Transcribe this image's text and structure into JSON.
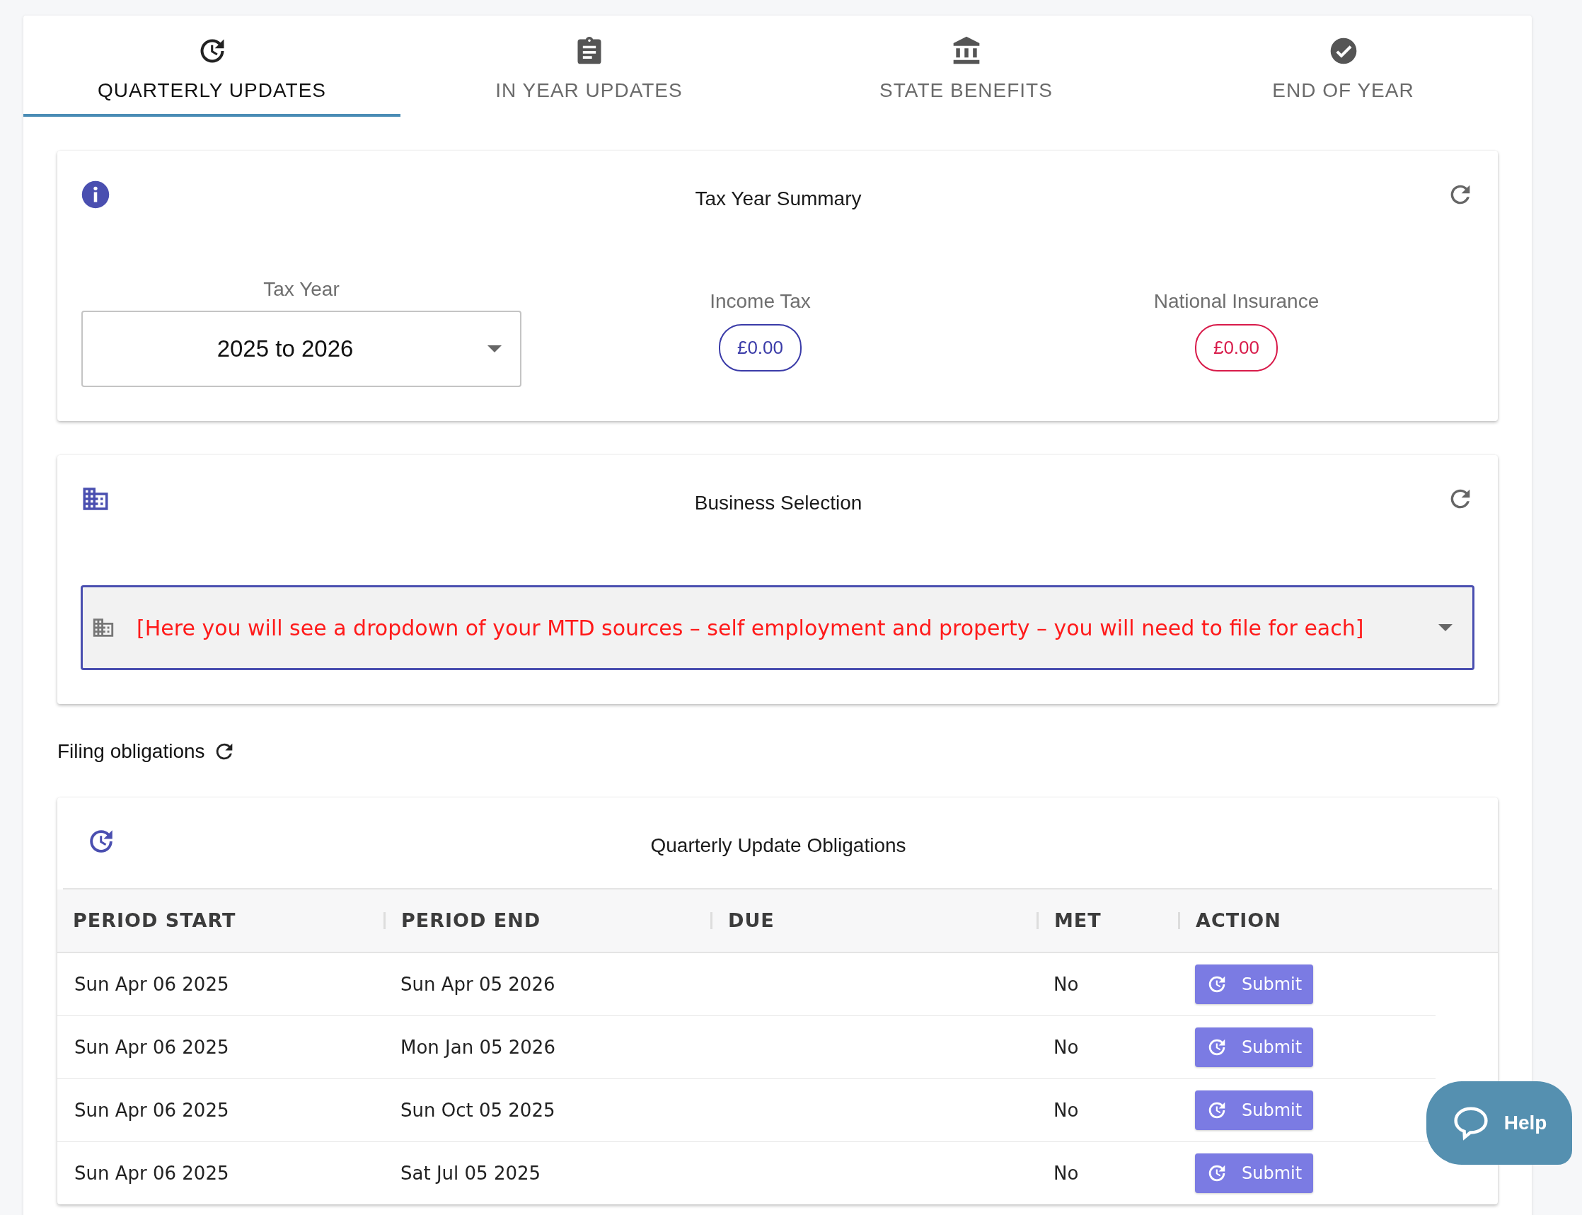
{
  "tabs": [
    {
      "label": "QUARTERLY UPDATES",
      "kind": "history",
      "selected": true
    },
    {
      "label": "IN YEAR UPDATES",
      "kind": "clipboard",
      "selected": false
    },
    {
      "label": "STATE BENEFITS",
      "kind": "bank",
      "selected": false
    },
    {
      "label": "END OF YEAR",
      "kind": "check",
      "selected": false
    }
  ],
  "tax_year_summary": {
    "title": "Tax Year Summary",
    "tax_year": {
      "label": "Tax Year",
      "value": "2025 to 2026"
    },
    "income_tax": {
      "label": "Income Tax",
      "amount": "£0.00"
    },
    "national_insurance": {
      "label": "National Insurance",
      "amount": "£0.00"
    }
  },
  "business_selection": {
    "title": "Business Selection",
    "placeholder": "[Here you will see a dropdown of your MTD sources – self employment and property – you will need to file for each]"
  },
  "filing_obligations": {
    "label": "Filing obligations"
  },
  "obligations": {
    "title": "Quarterly Update Obligations",
    "columns": [
      "PERIOD START",
      "PERIOD END",
      "DUE",
      "MET",
      "ACTION"
    ],
    "rows": [
      {
        "period_start": "Sun Apr 06 2025",
        "period_end": "Sun Apr 05 2026",
        "met": "No",
        "action": "Submit"
      },
      {
        "period_start": "Sun Apr 06 2025",
        "period_end": "Mon Jan 05 2026",
        "met": "No",
        "action": "Submit"
      },
      {
        "period_start": "Sun Apr 06 2025",
        "period_end": "Sun Oct 05 2025",
        "met": "No",
        "action": "Submit"
      },
      {
        "period_start": "Sun Apr 06 2025",
        "period_end": "Sat Jul 05 2025",
        "met": "No",
        "action": "Submit"
      }
    ]
  },
  "help": {
    "label": "Help"
  }
}
